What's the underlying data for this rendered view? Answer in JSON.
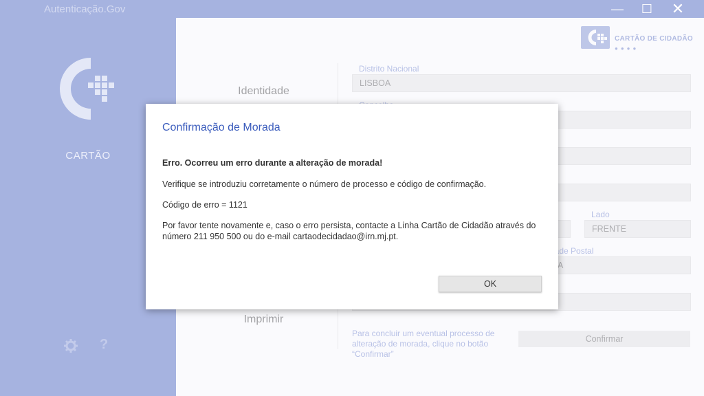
{
  "window": {
    "title": "Autenticação.Gov",
    "minimize_label": "—",
    "maximize_label": "☐",
    "close_label": "✕"
  },
  "sidebar": {
    "nav_cartao": "CARTÃO",
    "help_label": "?"
  },
  "brand": {
    "text": "CARTÃO DE CIDADÃO",
    "dots": "●●●●"
  },
  "menu": {
    "identidade": "Identidade",
    "imprimir": "Imprimir"
  },
  "form": {
    "distrito_label": "Distrito Nacional",
    "distrito_value": "LISBOA",
    "concelho_label": "Concelho",
    "lado_label": "Lado",
    "lado_value": "FRENTE",
    "localidade_postal_label_partial": "dade Postal",
    "localidade_postal_value_partial": "A",
    "note": "Para concluir um eventual processo de alteração de morada, clique no botão “Confirmar”",
    "confirm_button": "Confirmar"
  },
  "dialog": {
    "title": "Confirmação de Morada",
    "error_heading": "Erro. Ocorreu um erro durante a alteração de morada!",
    "paragraph1": "Verifique se introduziu corretamente o número de processo e código de confirmação.",
    "paragraph2": "Código de erro = 1121",
    "paragraph3": "Por favor tente novamente e, caso o erro persista, contacte a Linha Cartão de Cidadão através do número 211 950 500 ou do e-mail cartaodecidadao@irn.mj.pt.",
    "ok_button": "OK"
  },
  "colors": {
    "sidebar_bg": "#a6b3e0",
    "accent_blue": "#3c5dbd",
    "label_blue": "#9aa8dc"
  }
}
